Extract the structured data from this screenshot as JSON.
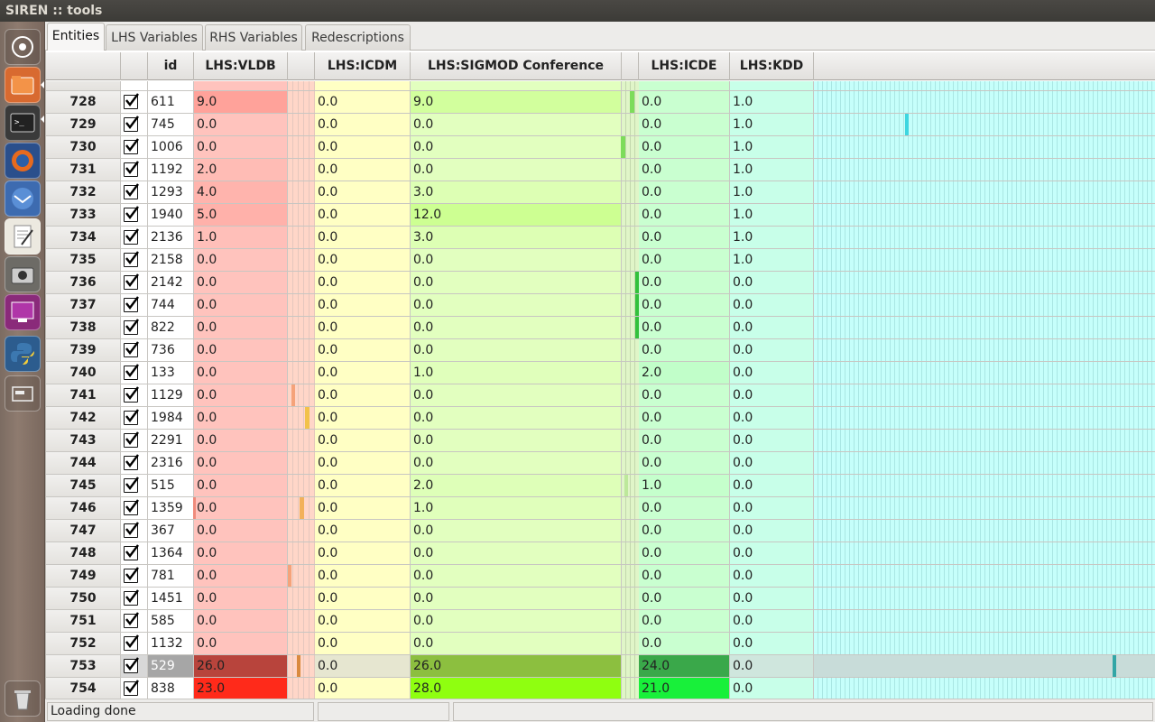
{
  "window": {
    "title": "SIREN :: tools"
  },
  "tabs": [
    {
      "label": "Entities",
      "active": true
    },
    {
      "label": "LHS Variables",
      "active": false
    },
    {
      "label": "RHS Variables",
      "active": false
    },
    {
      "label": "Redescriptions",
      "active": false
    }
  ],
  "launcher": [
    {
      "name": "dash-icon"
    },
    {
      "name": "files-icon"
    },
    {
      "name": "terminal-icon"
    },
    {
      "name": "firefox-icon"
    },
    {
      "name": "thunderbird-icon"
    },
    {
      "name": "text-editor-icon"
    },
    {
      "name": "screenshot-icon"
    },
    {
      "name": "workspace-icon"
    },
    {
      "name": "python-icon"
    },
    {
      "name": "window-icon"
    },
    {
      "name": "trash-icon"
    }
  ],
  "grid": {
    "columns": [
      "id",
      "LHS:VLDB",
      "LHS:ICDM",
      "LHS:SIGMOD Conference",
      "LHS:ICDE",
      "LHS:KDD"
    ],
    "partial_top_row": [
      "",
      "",
      "",
      "",
      "",
      ""
    ],
    "rows": [
      {
        "n": "728",
        "id": "611",
        "vldb": "9.0",
        "icdm": "0.0",
        "sigmod": "9.0",
        "icde": "0.0",
        "kdd": "1.0"
      },
      {
        "n": "729",
        "id": "745",
        "vldb": "0.0",
        "icdm": "0.0",
        "sigmod": "0.0",
        "icde": "0.0",
        "kdd": "1.0"
      },
      {
        "n": "730",
        "id": "1006",
        "vldb": "0.0",
        "icdm": "0.0",
        "sigmod": "0.0",
        "icde": "0.0",
        "kdd": "1.0"
      },
      {
        "n": "731",
        "id": "1192",
        "vldb": "2.0",
        "icdm": "0.0",
        "sigmod": "0.0",
        "icde": "0.0",
        "kdd": "1.0"
      },
      {
        "n": "732",
        "id": "1293",
        "vldb": "4.0",
        "icdm": "0.0",
        "sigmod": "3.0",
        "icde": "0.0",
        "kdd": "1.0"
      },
      {
        "n": "733",
        "id": "1940",
        "vldb": "5.0",
        "icdm": "0.0",
        "sigmod": "12.0",
        "icde": "0.0",
        "kdd": "1.0"
      },
      {
        "n": "734",
        "id": "2136",
        "vldb": "1.0",
        "icdm": "0.0",
        "sigmod": "3.0",
        "icde": "0.0",
        "kdd": "1.0"
      },
      {
        "n": "735",
        "id": "2158",
        "vldb": "0.0",
        "icdm": "0.0",
        "sigmod": "0.0",
        "icde": "0.0",
        "kdd": "1.0"
      },
      {
        "n": "736",
        "id": "2142",
        "vldb": "0.0",
        "icdm": "0.0",
        "sigmod": "0.0",
        "icde": "0.0",
        "kdd": "0.0"
      },
      {
        "n": "737",
        "id": "744",
        "vldb": "0.0",
        "icdm": "0.0",
        "sigmod": "0.0",
        "icde": "0.0",
        "kdd": "0.0"
      },
      {
        "n": "738",
        "id": "822",
        "vldb": "0.0",
        "icdm": "0.0",
        "sigmod": "0.0",
        "icde": "0.0",
        "kdd": "0.0"
      },
      {
        "n": "739",
        "id": "736",
        "vldb": "0.0",
        "icdm": "0.0",
        "sigmod": "0.0",
        "icde": "0.0",
        "kdd": "0.0"
      },
      {
        "n": "740",
        "id": "133",
        "vldb": "0.0",
        "icdm": "0.0",
        "sigmod": "1.0",
        "icde": "2.0",
        "kdd": "0.0"
      },
      {
        "n": "741",
        "id": "1129",
        "vldb": "0.0",
        "icdm": "0.0",
        "sigmod": "0.0",
        "icde": "0.0",
        "kdd": "0.0"
      },
      {
        "n": "742",
        "id": "1984",
        "vldb": "0.0",
        "icdm": "0.0",
        "sigmod": "0.0",
        "icde": "0.0",
        "kdd": "0.0"
      },
      {
        "n": "743",
        "id": "2291",
        "vldb": "0.0",
        "icdm": "0.0",
        "sigmod": "0.0",
        "icde": "0.0",
        "kdd": "0.0"
      },
      {
        "n": "744",
        "id": "2316",
        "vldb": "0.0",
        "icdm": "0.0",
        "sigmod": "0.0",
        "icde": "0.0",
        "kdd": "0.0"
      },
      {
        "n": "745",
        "id": "515",
        "vldb": "0.0",
        "icdm": "0.0",
        "sigmod": "2.0",
        "icde": "1.0",
        "kdd": "0.0"
      },
      {
        "n": "746",
        "id": "1359",
        "vldb": "0.0",
        "icdm": "0.0",
        "sigmod": "1.0",
        "icde": "0.0",
        "kdd": "0.0"
      },
      {
        "n": "747",
        "id": "367",
        "vldb": "0.0",
        "icdm": "0.0",
        "sigmod": "0.0",
        "icde": "0.0",
        "kdd": "0.0"
      },
      {
        "n": "748",
        "id": "1364",
        "vldb": "0.0",
        "icdm": "0.0",
        "sigmod": "0.0",
        "icde": "0.0",
        "kdd": "0.0"
      },
      {
        "n": "749",
        "id": "781",
        "vldb": "0.0",
        "icdm": "0.0",
        "sigmod": "0.0",
        "icde": "0.0",
        "kdd": "0.0"
      },
      {
        "n": "750",
        "id": "1451",
        "vldb": "0.0",
        "icdm": "0.0",
        "sigmod": "0.0",
        "icde": "0.0",
        "kdd": "0.0"
      },
      {
        "n": "751",
        "id": "585",
        "vldb": "0.0",
        "icdm": "0.0",
        "sigmod": "0.0",
        "icde": "0.0",
        "kdd": "0.0"
      },
      {
        "n": "752",
        "id": "1132",
        "vldb": "0.0",
        "icdm": "0.0",
        "sigmod": "0.0",
        "icde": "0.0",
        "kdd": "0.0"
      },
      {
        "n": "753",
        "id": "529",
        "vldb": "26.0",
        "icdm": "0.0",
        "sigmod": "26.0",
        "icde": "24.0",
        "kdd": "0.0",
        "selected": true
      },
      {
        "n": "754",
        "id": "838",
        "vldb": "23.0",
        "icdm": "0.0",
        "sigmod": "28.0",
        "icde": "21.0",
        "kdd": "0.0",
        "highlight": true
      }
    ]
  },
  "colors": {
    "vldb": "#ffc3bd",
    "icdm": "#ffffc4",
    "sigmod": "#e2ffbf",
    "icde": "#c9ffd0",
    "kdd": "#c8ffe9",
    "rest": "#c6fffb",
    "vldb_strong": "#ff2a1a",
    "sigmod_strong": "#8fff10",
    "icde_strong": "#18f03a"
  },
  "status": {
    "message": "Loading done",
    "segment2": "",
    "segment3": ""
  }
}
